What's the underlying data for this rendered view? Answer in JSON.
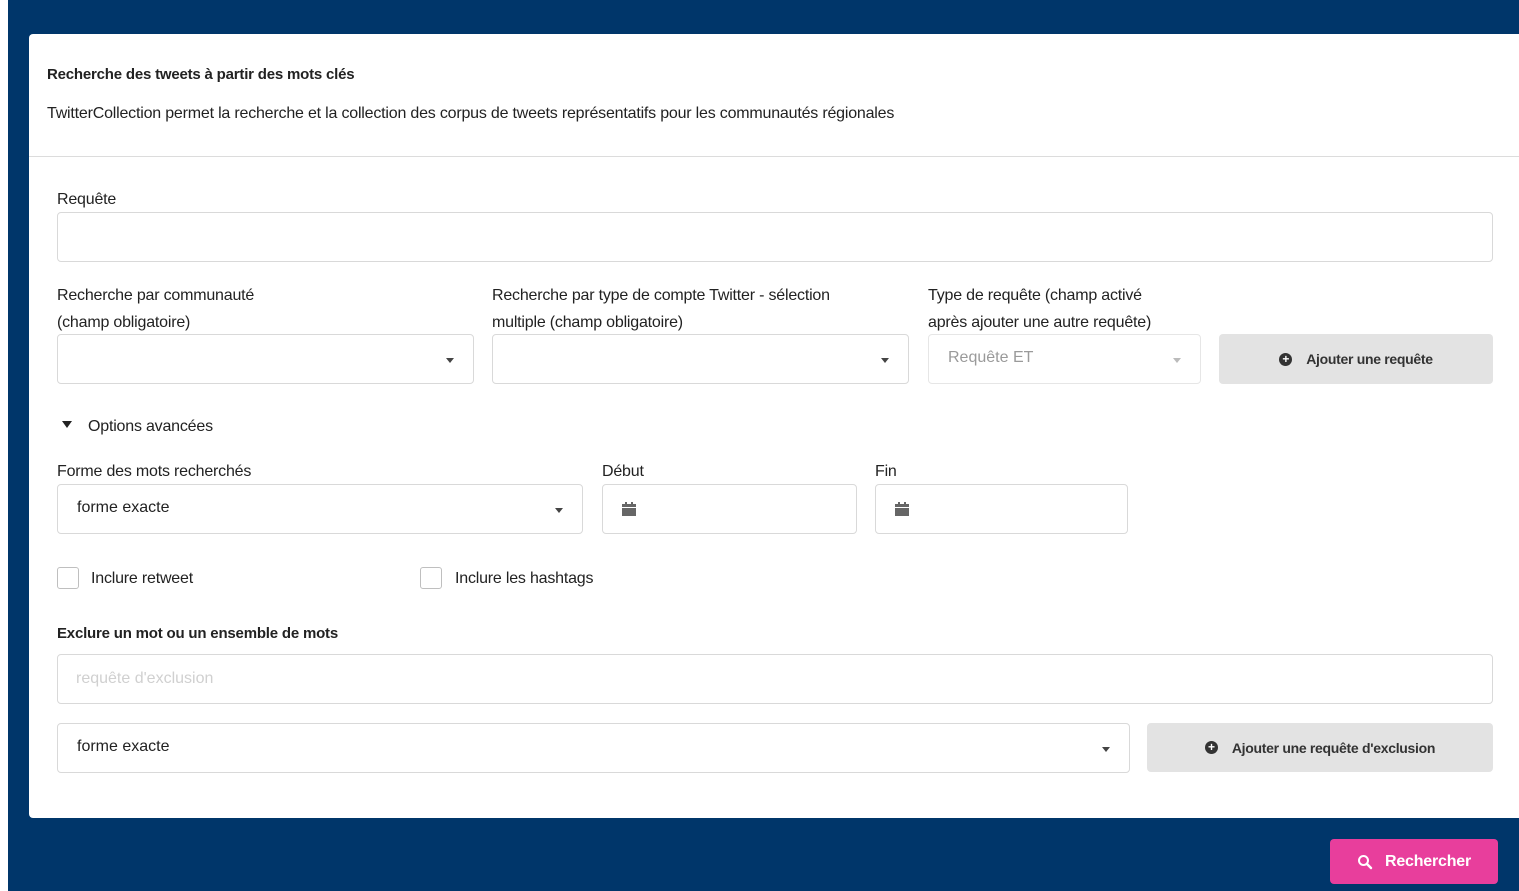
{
  "header": {
    "title": "Recherche des tweets à partir des mots clés",
    "subtitle": "TwitterCollection permet la recherche et la collection des corpus de tweets représentatifs pour les communautés régionales"
  },
  "query": {
    "label": "Requête",
    "value": ""
  },
  "community": {
    "label_line1": "Recherche par communauté",
    "label_line2": "(champ obligatoire)",
    "value": ""
  },
  "account_type": {
    "label_line1": "Recherche par type de compte Twitter - sélection",
    "label_line2": "multiple (champ obligatoire)",
    "value": ""
  },
  "query_type": {
    "label_line1": "Type de requête (champ activé",
    "label_line2": "après ajouter une autre requête)",
    "value": "Requête ET"
  },
  "add_query_label": "Ajouter une requête",
  "advanced": {
    "toggle_label": "Options avancées",
    "word_form_label": "Forme des mots recherchés",
    "word_form_value": "forme exacte",
    "start_label": "Début",
    "end_label": "Fin",
    "include_retweet_label": "Inclure retweet",
    "include_hashtags_label": "Inclure les hashtags"
  },
  "exclusion": {
    "title": "Exclure un mot ou un ensemble de mots",
    "placeholder": "requête d'exclusion",
    "form_value": "forme exacte",
    "add_label": "Ajouter une requête d'exclusion"
  },
  "search_button_label": "Rechercher",
  "colors": {
    "background": "#00366a",
    "accent": "#e83e9c",
    "button_grey": "#e3e3e3"
  }
}
